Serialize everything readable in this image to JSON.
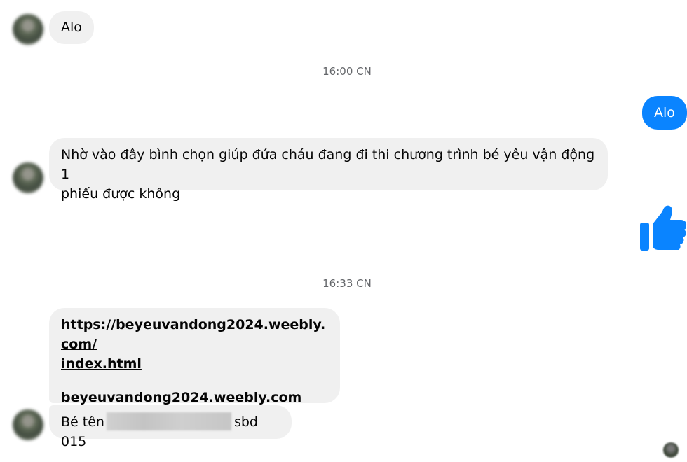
{
  "messages": [
    {
      "id": "m1",
      "direction": "incoming",
      "text": "Alo"
    },
    {
      "id": "t1",
      "type": "timestamp",
      "text": "16:00 CN"
    },
    {
      "id": "m2",
      "direction": "outgoing",
      "text": "Alo"
    },
    {
      "id": "m3",
      "direction": "incoming",
      "line1": "Nhờ vào đây bình chọn giúp đứa cháu đang đi thi chương trình bé yêu vận động 1",
      "line2": "phiếu được không"
    },
    {
      "id": "m4",
      "direction": "outgoing",
      "type": "like",
      "icon": "thumbs-up-icon"
    },
    {
      "id": "t2",
      "type": "timestamp",
      "text": "16:33 CN"
    },
    {
      "id": "m5",
      "direction": "incoming",
      "type": "link",
      "url_line1": "https://beyeuvandong2024.weebly.com/",
      "url_line2": "index.html",
      "domain": "beyeuvandong2024.weebly.com"
    },
    {
      "id": "m6",
      "direction": "incoming",
      "text_before": "Bé tên",
      "text_after": "sbd 015"
    }
  ],
  "colors": {
    "outgoing_bubble": "#0a84ff",
    "incoming_bubble": "#f0f0f0",
    "like_icon": "#0a84ff",
    "timestamp_text": "#65676b"
  }
}
